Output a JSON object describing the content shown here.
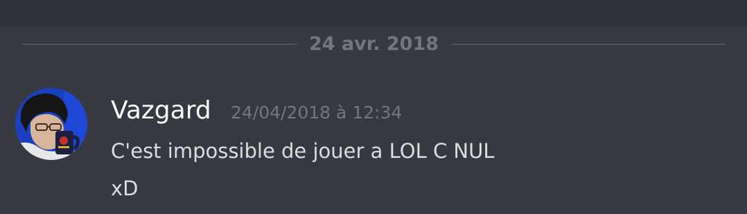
{
  "date_divider": {
    "label": "24 avr. 2018"
  },
  "message": {
    "author": "Vazgard",
    "timestamp": "24/04/2018 à 12:34",
    "lines": [
      "C'est impossible de jouer a LOL C NUL",
      "xD"
    ]
  },
  "colors": {
    "background": "#36393f",
    "top_bar": "#2f3136",
    "divider": "#4f545c",
    "muted_text": "#72767d",
    "author_text": "#ffffff",
    "body_text": "#dcddde",
    "avatar_accent": "#1a40c0"
  },
  "icons": {
    "avatar": "user-avatar-photo"
  }
}
